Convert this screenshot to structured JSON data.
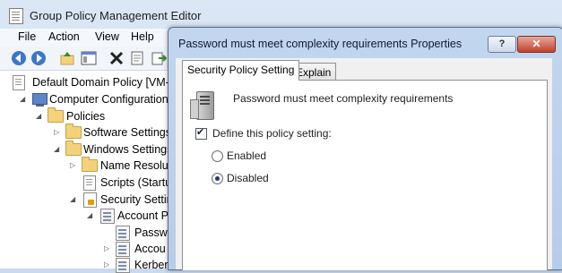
{
  "main_window": {
    "title": "Group Policy Management Editor",
    "menu": [
      "File",
      "Action",
      "View",
      "Help"
    ],
    "toolbar_icons": [
      "back-arrow-icon",
      "forward-arrow-icon",
      "up-folder-icon",
      "show-hide-tree-icon",
      "delete-icon",
      "properties-icon",
      "export-icon"
    ],
    "tree": [
      {
        "label": "Default Domain Policy [VM-S",
        "icon": "policy-doc-icon",
        "level": 0
      },
      {
        "label": "Computer Configuration",
        "icon": "computer-icon",
        "level": 1,
        "expanded": true
      },
      {
        "label": "Policies",
        "icon": "folder-icon",
        "level": 2,
        "expanded": true
      },
      {
        "label": "Software Settings",
        "icon": "folder-icon",
        "level": 3,
        "expanded": false
      },
      {
        "label": "Windows Settings",
        "icon": "folder-icon",
        "level": 3,
        "expanded": true
      },
      {
        "label": "Name Resolut",
        "icon": "folder-icon",
        "level": 4,
        "expanded": false
      },
      {
        "label": "Scripts (Startup",
        "icon": "script-icon",
        "level": 4
      },
      {
        "label": "Security Settin",
        "icon": "security-icon",
        "level": 4,
        "expanded": true
      },
      {
        "label": "Account P",
        "icon": "policy-icon",
        "level": 5,
        "expanded": true
      },
      {
        "label": "Passwo",
        "icon": "policy-icon",
        "level": 6
      },
      {
        "label": "Accou",
        "icon": "policy-icon",
        "level": 6,
        "expanded": false
      },
      {
        "label": "Kerbero",
        "icon": "policy-icon",
        "level": 6,
        "expanded": false
      }
    ]
  },
  "dialog": {
    "title": "Password must meet complexity requirements Properties",
    "help_label": "?",
    "close_label": "✕",
    "tabs": [
      {
        "label": "Security Policy Setting",
        "active": true
      },
      {
        "label": "Explain",
        "active": false
      }
    ],
    "policy_name": "Password must meet complexity requirements",
    "define_label": "Define this policy setting:",
    "define_checked": true,
    "options": [
      {
        "label": "Enabled",
        "selected": false
      },
      {
        "label": "Disabled",
        "selected": true
      }
    ]
  }
}
